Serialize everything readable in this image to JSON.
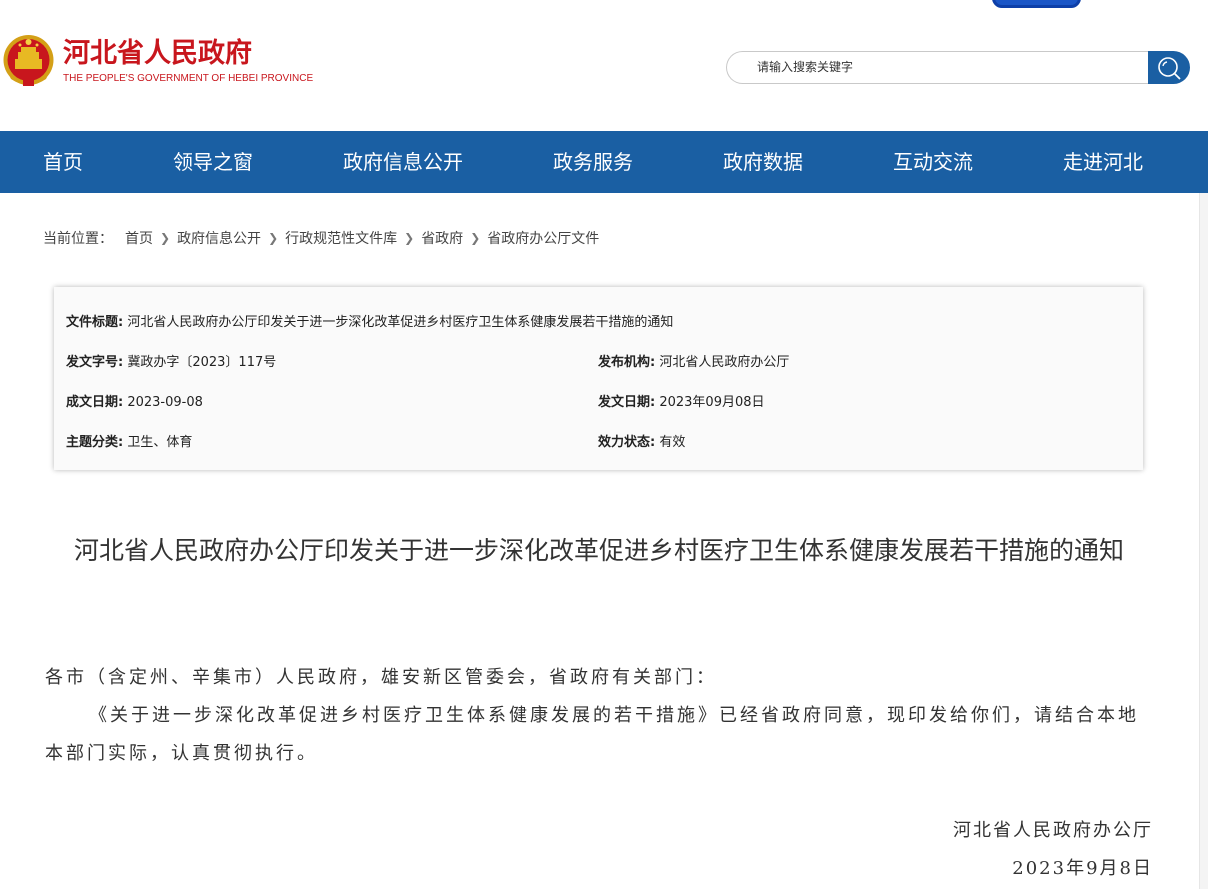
{
  "site": {
    "name_cn": "河北省人民政府",
    "name_en": "THE PEOPLE'S GOVERNMENT OF HEBEI PROVINCE",
    "brand_color": "#c8161d",
    "nav_color": "#1a5fa3"
  },
  "search": {
    "placeholder": "请输入搜索关键字",
    "button_icon": "search-icon"
  },
  "nav": {
    "items": [
      "首页",
      "领导之窗",
      "政府信息公开",
      "政务服务",
      "政府数据",
      "互动交流",
      "走进河北"
    ]
  },
  "breadcrumb": {
    "prefix": "当前位置：",
    "items": [
      "首页",
      "政府信息公开",
      "行政规范性文件库",
      "省政府",
      "省政府办公厅文件"
    ]
  },
  "info": {
    "title_label": "文件标题:",
    "title_value": "河北省人民政府办公厅印发关于进一步深化改革促进乡村医疗卫生体系健康发展若干措施的通知",
    "doc_no_label": "发文字号:",
    "doc_no_value": "冀政办字〔2023〕117号",
    "issuer_label": "发布机构:",
    "issuer_value": "河北省人民政府办公厅",
    "created_label": "成文日期:",
    "created_value": "2023-09-08",
    "issued_label": "发文日期:",
    "issued_value": "2023年09月08日",
    "topic_label": "主题分类:",
    "topic_value": "卫生、体育",
    "status_label": "效力状态:",
    "status_value": "有效"
  },
  "article": {
    "title": "河北省人民政府办公厅印发关于进一步深化改革促进乡村医疗卫生体系健康发展若干措施的通知",
    "salutation": "各市（含定州、辛集市）人民政府，雄安新区管委会，省政府有关部门：",
    "body": "《关于进一步深化改革促进乡村医疗卫生体系健康发展的若干措施》已经省政府同意，现印发给你们，请结合本地本部门实际，认真贯彻执行。",
    "signature": "河北省人民政府办公厅",
    "date": "2023年9月8日"
  }
}
